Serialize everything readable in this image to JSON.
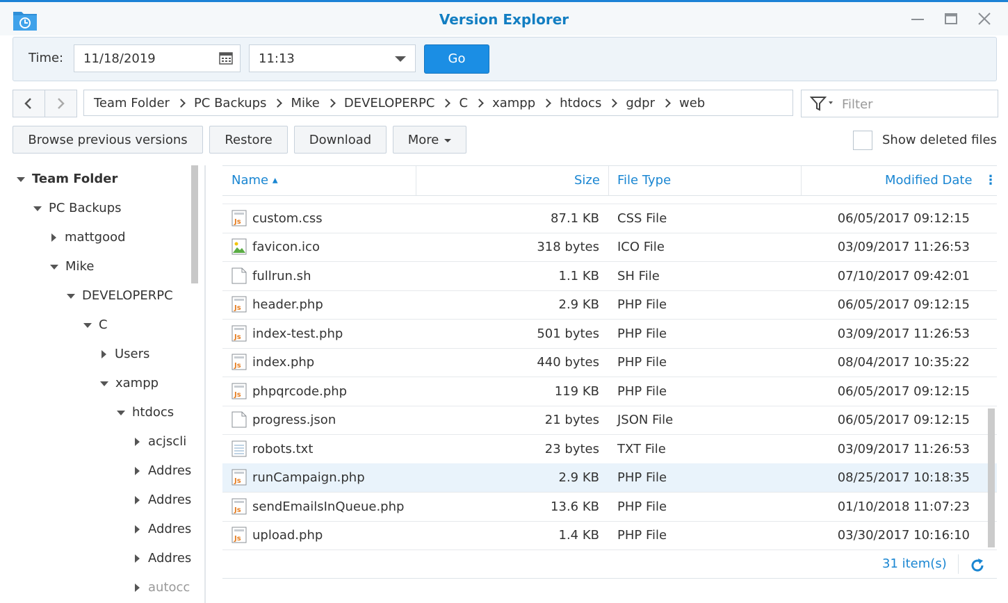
{
  "window": {
    "title": "Version Explorer"
  },
  "timebar": {
    "label": "Time:",
    "date": "11/18/2019",
    "time": "11:13",
    "go_label": "Go"
  },
  "breadcrumb": [
    "Team Folder",
    "PC Backups",
    "Mike",
    "DEVELOPERPC",
    "C",
    "xampp",
    "htdocs",
    "gdpr",
    "web"
  ],
  "filter": {
    "placeholder": "Filter"
  },
  "toolbar": {
    "browse_label": "Browse previous versions",
    "restore_label": "Restore",
    "download_label": "Download",
    "more_label": "More",
    "show_deleted_label": "Show deleted files"
  },
  "tree": [
    {
      "label": "Team Folder",
      "expanded": true
    },
    {
      "label": "PC Backups",
      "expanded": true
    },
    {
      "label": "mattgood",
      "expanded": false
    },
    {
      "label": "Mike",
      "expanded": true
    },
    {
      "label": "DEVELOPERPC",
      "expanded": true
    },
    {
      "label": "C",
      "expanded": true
    },
    {
      "label": "Users",
      "expanded": false
    },
    {
      "label": "xampp",
      "expanded": true
    },
    {
      "label": "htdocs",
      "expanded": true
    },
    {
      "label": "acjscli",
      "expanded": false
    },
    {
      "label": "Addres",
      "expanded": false
    },
    {
      "label": "Addres",
      "expanded": false
    },
    {
      "label": "Addres",
      "expanded": false
    },
    {
      "label": "Addres",
      "expanded": false
    },
    {
      "label": "autocc",
      "expanded": false
    }
  ],
  "table": {
    "columns": {
      "name": "Name",
      "size": "Size",
      "type": "File Type",
      "modified": "Modified Date"
    },
    "rows": [
      {
        "name": "custom.css",
        "size": "87.1 KB",
        "type": "CSS File",
        "modified": "06/05/2017 09:12:15",
        "icon": "code-file-icon"
      },
      {
        "name": "favicon.ico",
        "size": "318 bytes",
        "type": "ICO File",
        "modified": "03/09/2017 11:26:53",
        "icon": "image-file-icon"
      },
      {
        "name": "fullrun.sh",
        "size": "1.1 KB",
        "type": "SH File",
        "modified": "07/10/2017 09:42:01",
        "icon": "blank-file-icon"
      },
      {
        "name": "header.php",
        "size": "2.9 KB",
        "type": "PHP File",
        "modified": "06/05/2017 09:12:15",
        "icon": "code-file-icon"
      },
      {
        "name": "index-test.php",
        "size": "501 bytes",
        "type": "PHP File",
        "modified": "03/09/2017 11:26:53",
        "icon": "code-file-icon"
      },
      {
        "name": "index.php",
        "size": "440 bytes",
        "type": "PHP File",
        "modified": "08/04/2017 10:35:22",
        "icon": "code-file-icon"
      },
      {
        "name": "phpqrcode.php",
        "size": "119 KB",
        "type": "PHP File",
        "modified": "06/05/2017 09:12:15",
        "icon": "code-file-icon"
      },
      {
        "name": "progress.json",
        "size": "21 bytes",
        "type": "JSON File",
        "modified": "06/05/2017 09:12:15",
        "icon": "blank-file-icon"
      },
      {
        "name": "robots.txt",
        "size": "23 bytes",
        "type": "TXT File",
        "modified": "03/09/2017 11:26:53",
        "icon": "text-file-icon"
      },
      {
        "name": "runCampaign.php",
        "size": "2.9 KB",
        "type": "PHP File",
        "modified": "08/25/2017 10:18:35",
        "icon": "code-file-icon",
        "selected": true
      },
      {
        "name": "sendEmailsInQueue.php",
        "size": "13.6 KB",
        "type": "PHP File",
        "modified": "01/10/2018 11:07:23",
        "icon": "code-file-icon"
      },
      {
        "name": "upload.php",
        "size": "1.4 KB",
        "type": "PHP File",
        "modified": "03/30/2017 10:16:10",
        "icon": "code-file-icon"
      }
    ]
  },
  "footer": {
    "item_count": "31 item(s)"
  },
  "colors": {
    "accent": "#1b8ee4",
    "header_text": "#1a86d2",
    "selected_row": "#e9f3fb"
  }
}
